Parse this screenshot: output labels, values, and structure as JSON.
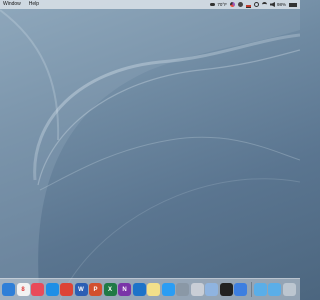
{
  "menubar": {
    "items": [
      {
        "label": "Window"
      },
      {
        "label": "Help"
      }
    ],
    "status": {
      "temperature": "70°F",
      "battery": "98%"
    }
  },
  "dock": {
    "apps": [
      {
        "name": "finder-icon",
        "label": "",
        "color": "#2f7fd8"
      },
      {
        "name": "calendar-icon",
        "label": "8",
        "color": "#f2f2f2"
      },
      {
        "name": "photo-icon",
        "label": "",
        "color": "#e84b5a"
      },
      {
        "name": "safari-icon",
        "label": "",
        "color": "#1e8fe6"
      },
      {
        "name": "chrome-icon",
        "label": "",
        "color": "#dd4436"
      },
      {
        "name": "word-icon",
        "label": "W",
        "color": "#2b5fb4"
      },
      {
        "name": "powerpoint-icon",
        "label": "P",
        "color": "#d2502e"
      },
      {
        "name": "excel-icon",
        "label": "X",
        "color": "#1f7a45"
      },
      {
        "name": "onenote-icon",
        "label": "N",
        "color": "#7a35a8"
      },
      {
        "name": "outlook-icon",
        "label": "",
        "color": "#1d73c9"
      },
      {
        "name": "notes-icon",
        "label": "",
        "color": "#f2e08a"
      },
      {
        "name": "appstore-icon",
        "label": "",
        "color": "#2a9df4"
      },
      {
        "name": "utility-icon",
        "label": "",
        "color": "#8a98a6"
      },
      {
        "name": "preview-icon",
        "label": "",
        "color": "#c9ced6"
      },
      {
        "name": "app-icon",
        "label": "",
        "color": "#8fb4e0"
      },
      {
        "name": "terminal-icon",
        "label": "",
        "color": "#222222"
      },
      {
        "name": "app-blue-icon",
        "label": "",
        "color": "#3d7fe0"
      },
      {
        "name": "folder-icon",
        "label": "",
        "color": "#5aaee8"
      },
      {
        "name": "folder-icon-2",
        "label": "",
        "color": "#5aaee8"
      },
      {
        "name": "trash-icon",
        "label": "",
        "color": "#bcc6d0"
      }
    ]
  }
}
